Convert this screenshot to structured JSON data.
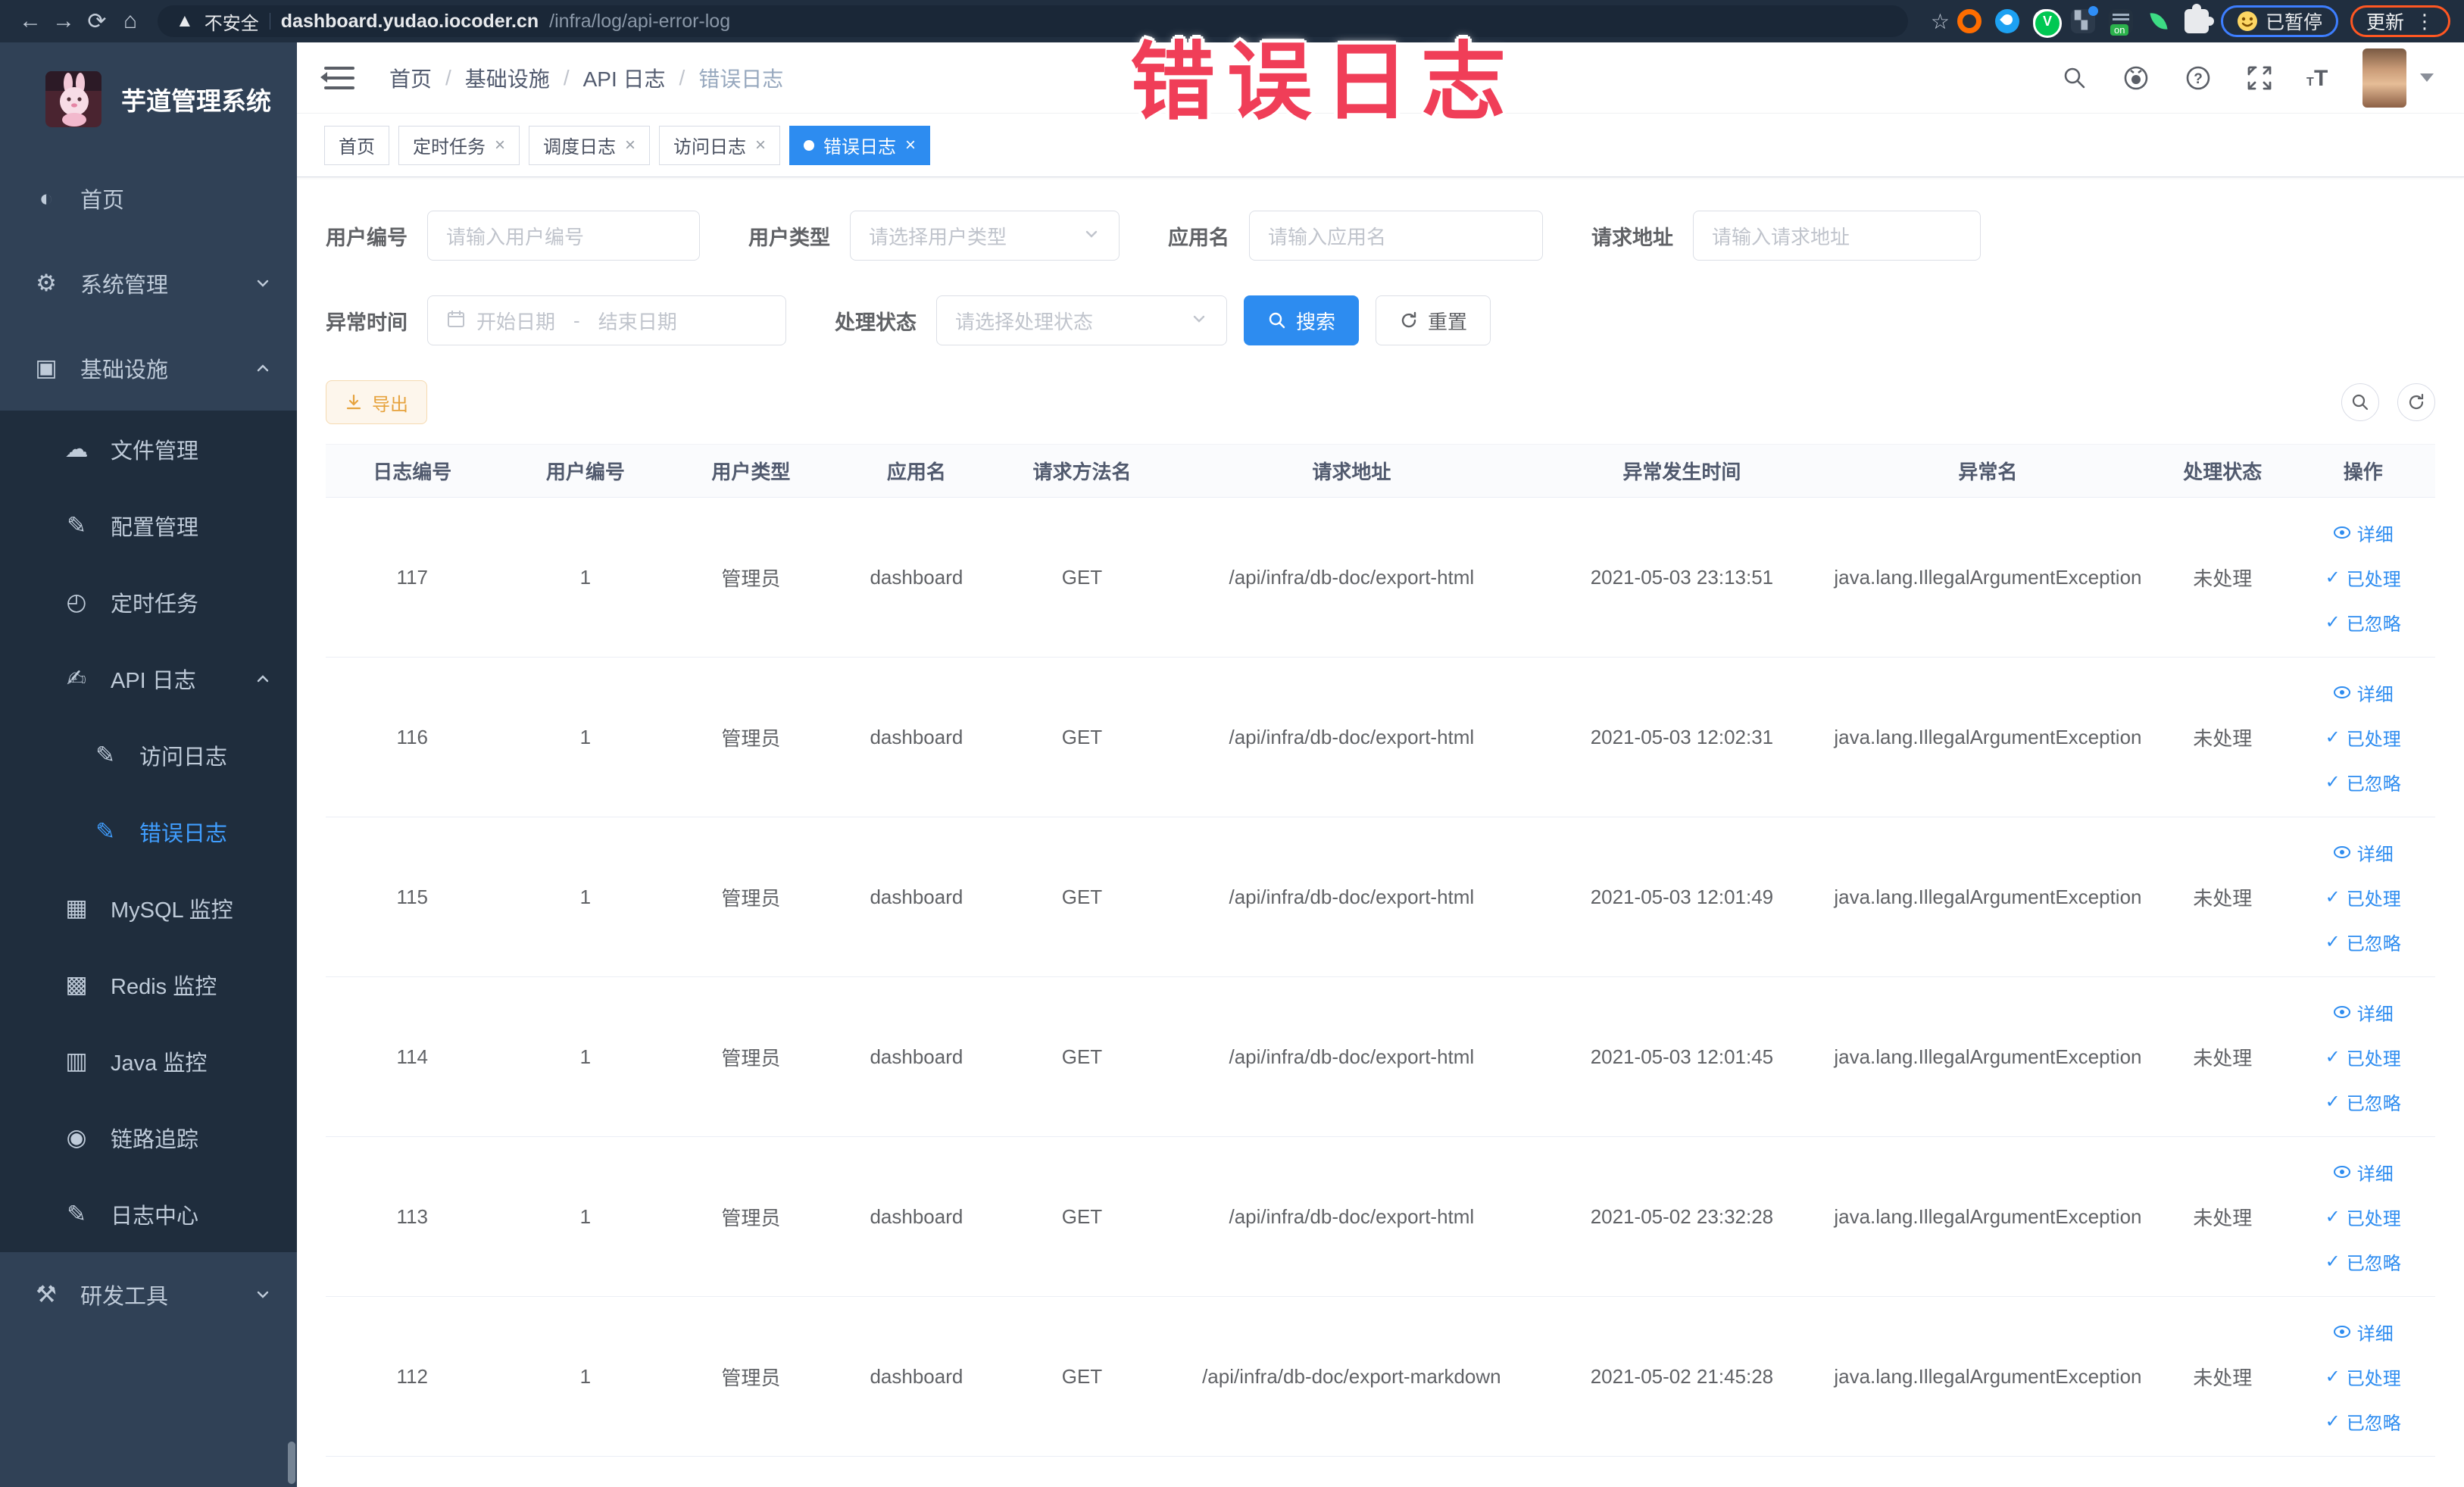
{
  "browser": {
    "security_label": "不安全",
    "url_domain": "dashboard.yudao.iocoder.cn",
    "url_path": "/infra/log/api-error-log",
    "paused_badge": "已暂停",
    "update_button": "更新"
  },
  "annotation": {
    "text": "错误日志"
  },
  "sidebar": {
    "title": "芋道管理系统",
    "items": [
      {
        "label": "首页"
      },
      {
        "label": "系统管理"
      },
      {
        "label": "基础设施"
      },
      {
        "label": "文件管理"
      },
      {
        "label": "配置管理"
      },
      {
        "label": "定时任务"
      },
      {
        "label": "API 日志"
      },
      {
        "label": "访问日志"
      },
      {
        "label": "错误日志",
        "active": true
      },
      {
        "label": "MySQL 监控"
      },
      {
        "label": "Redis 监控"
      },
      {
        "label": "Java 监控"
      },
      {
        "label": "链路追踪"
      },
      {
        "label": "日志中心"
      },
      {
        "label": "研发工具"
      }
    ]
  },
  "breadcrumb": [
    "首页",
    "基础设施",
    "API 日志",
    "错误日志"
  ],
  "tabs": [
    {
      "label": "首页"
    },
    {
      "label": "定时任务"
    },
    {
      "label": "调度日志"
    },
    {
      "label": "访问日志"
    },
    {
      "label": "错误日志",
      "active": true
    }
  ],
  "filters": {
    "user_id_label": "用户编号",
    "user_id_placeholder": "请输入用户编号",
    "user_type_label": "用户类型",
    "user_type_placeholder": "请选择用户类型",
    "app_name_label": "应用名",
    "app_name_placeholder": "请输入应用名",
    "request_url_label": "请求地址",
    "request_url_placeholder": "请输入请求地址",
    "exception_time_label": "异常时间",
    "start_placeholder": "开始日期",
    "range_separator": "-",
    "end_placeholder": "结束日期",
    "process_status_label": "处理状态",
    "process_status_placeholder": "请选择处理状态",
    "search_button": "搜索",
    "reset_button": "重置"
  },
  "toolbar": {
    "export_button": "导出"
  },
  "table": {
    "columns": [
      "日志编号",
      "用户编号",
      "用户类型",
      "应用名",
      "请求方法名",
      "请求地址",
      "异常发生时间",
      "异常名",
      "处理状态",
      "操作"
    ],
    "actions": [
      "详细",
      "已处理",
      "已忽略"
    ],
    "rows": [
      {
        "id": "117",
        "user_id": "1",
        "user_type": "管理员",
        "app": "dashboard",
        "method": "GET",
        "url": "/api/infra/db-doc/export-html",
        "time": "2021-05-03 23:13:51",
        "exception": "java.lang.IllegalArgumentException",
        "status": "未处理"
      },
      {
        "id": "116",
        "user_id": "1",
        "user_type": "管理员",
        "app": "dashboard",
        "method": "GET",
        "url": "/api/infra/db-doc/export-html",
        "time": "2021-05-03 12:02:31",
        "exception": "java.lang.IllegalArgumentException",
        "status": "未处理"
      },
      {
        "id": "115",
        "user_id": "1",
        "user_type": "管理员",
        "app": "dashboard",
        "method": "GET",
        "url": "/api/infra/db-doc/export-html",
        "time": "2021-05-03 12:01:49",
        "exception": "java.lang.IllegalArgumentException",
        "status": "未处理"
      },
      {
        "id": "114",
        "user_id": "1",
        "user_type": "管理员",
        "app": "dashboard",
        "method": "GET",
        "url": "/api/infra/db-doc/export-html",
        "time": "2021-05-03 12:01:45",
        "exception": "java.lang.IllegalArgumentException",
        "status": "未处理"
      },
      {
        "id": "113",
        "user_id": "1",
        "user_type": "管理员",
        "app": "dashboard",
        "method": "GET",
        "url": "/api/infra/db-doc/export-html",
        "time": "2021-05-02 23:32:28",
        "exception": "java.lang.IllegalArgumentException",
        "status": "未处理"
      },
      {
        "id": "112",
        "user_id": "1",
        "user_type": "管理员",
        "app": "dashboard",
        "method": "GET",
        "url": "/api/infra/db-doc/export-markdown",
        "time": "2021-05-02 21:45:28",
        "exception": "java.lang.IllegalArgumentException",
        "status": "未处理"
      }
    ]
  },
  "colors": {
    "accent": "#2d8cf0",
    "link": "#409eff",
    "warning": "#e6a23c",
    "sidebar_bg": "#304156",
    "submenu_bg": "#1f2d3d",
    "annotation": "#f03e58",
    "chrome_bg": "#202e3f"
  }
}
